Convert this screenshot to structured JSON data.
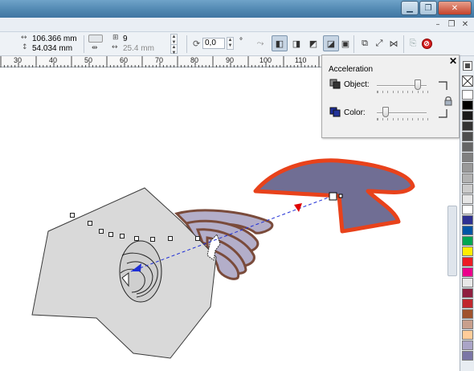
{
  "propbar": {
    "width_value": "106.366 mm",
    "height_value": "54.034 mm",
    "steps_value": "9",
    "spacing_value": "25.4 mm",
    "angle_value": "0,0",
    "degree_symbol": "°"
  },
  "ruler": {
    "labels": [
      "30",
      "40",
      "50",
      "60",
      "70",
      "80",
      "90",
      "100",
      "110"
    ]
  },
  "docker": {
    "title": "Acceleration",
    "object_label": "Object:",
    "color_label": "Color:",
    "object_acceleration": 0.83,
    "color_acceleration": 0.18,
    "close_icon": "close-icon",
    "lock_icon": "lock-icon"
  },
  "palette": {
    "colors": [
      "#ffffff",
      "#000000",
      "#1a1a1a",
      "#333333",
      "#4d4d4d",
      "#666666",
      "#808080",
      "#999999",
      "#b3b3b3",
      "#cccccc",
      "#e6e6e6",
      "#ffffff",
      "#2e3192",
      "#0055a5",
      "#00a651",
      "#ffed00",
      "#ed1c24",
      "#ec008c",
      "#e8e8e8",
      "#8f1f3f",
      "#c1272d",
      "#a0522d",
      "#c89f8c",
      "#ffcc99",
      "#aaa5c7",
      "#7b76a6"
    ],
    "accent": "#3f76a2"
  },
  "drawing": {
    "start_fill": "#d9d9d9",
    "end_fill": "#706e94",
    "end_outline": "#e8421b",
    "blend_outline": "#7a4b3b",
    "vector_color": "#1f2fd6",
    "marker_color": "#e00000"
  }
}
